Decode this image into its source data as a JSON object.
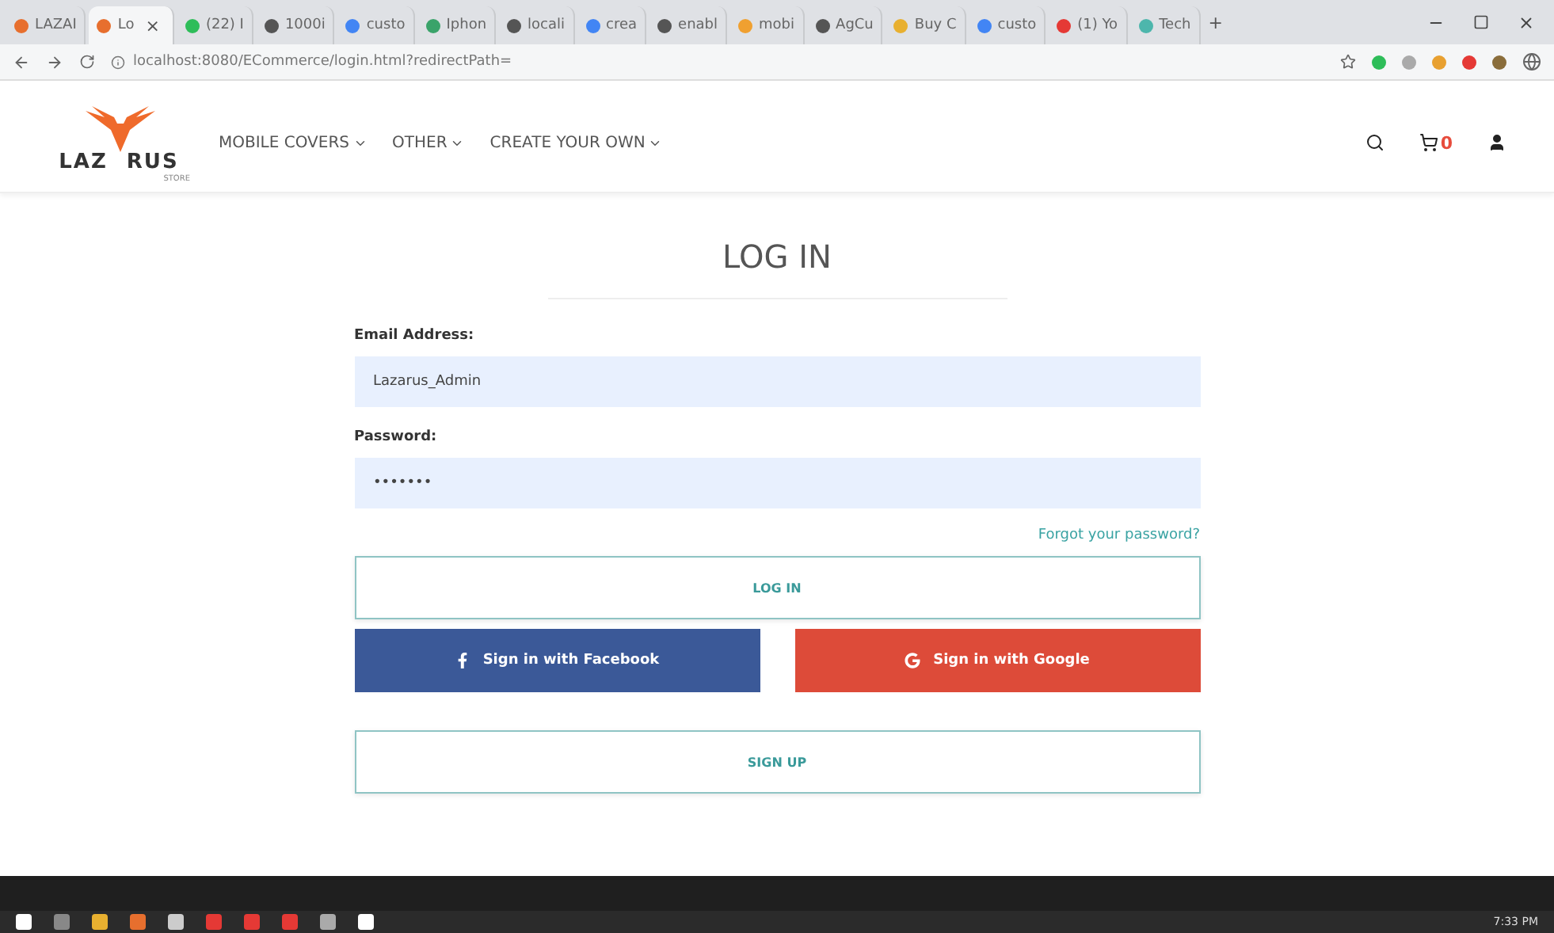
{
  "browser": {
    "tabs": [
      {
        "title": "LAZAI",
        "selected": false
      },
      {
        "title": "Lo",
        "selected": true
      },
      {
        "title": "(22) I",
        "selected": false
      },
      {
        "title": "1000i",
        "selected": false
      },
      {
        "title": "custo",
        "selected": false
      },
      {
        "title": "Iphon",
        "selected": false
      },
      {
        "title": "locali",
        "selected": false
      },
      {
        "title": "crea",
        "selected": false
      },
      {
        "title": "enabl",
        "selected": false
      },
      {
        "title": "mobi",
        "selected": false
      },
      {
        "title": "AgCu",
        "selected": false
      },
      {
        "title": "Buy C",
        "selected": false
      },
      {
        "title": "custo",
        "selected": false
      },
      {
        "title": "(1) Yo",
        "selected": false
      },
      {
        "title": "Tech",
        "selected": false
      }
    ],
    "close_tab": "×",
    "new_tab": "+",
    "address": "localhost:8080/ECommerce/login.html?redirectPath="
  },
  "navbar": {
    "logo_left": "LAZ",
    "logo_right": "RUS",
    "logo_sub": "STORE",
    "menu": [
      {
        "label": "MOBILE COVERS"
      },
      {
        "label": "OTHER"
      },
      {
        "label": "CREATE YOUR OWN"
      }
    ],
    "cart_count": "0"
  },
  "form": {
    "title": "LOG IN",
    "email_label": "Email Address:",
    "email_value": "Lazarus_Admin",
    "password_label": "Password:",
    "password_value": "•••••••",
    "forgot": "Forgot your password?",
    "login_button": "LOG IN",
    "facebook_button": "Sign in with Facebook",
    "google_button": "Sign in with Google",
    "signup_button": "SIGN UP"
  },
  "taskbar": {
    "time": "7:33 PM"
  }
}
